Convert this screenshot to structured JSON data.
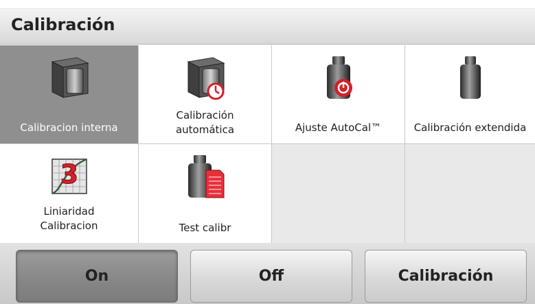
{
  "header": {
    "title": "Calibración"
  },
  "tiles": [
    {
      "label_line1": "Calibracion interna",
      "label_line2": "",
      "icon": "internal-weight-block-icon",
      "selected": true
    },
    {
      "label_line1": "Calibración",
      "label_line2": "automática",
      "icon": "auto-calibration-timer-icon",
      "selected": false
    },
    {
      "label_line1": "Ajuste AutoCal™",
      "label_line2": "",
      "icon": "autocal-weight-icon",
      "selected": false
    },
    {
      "label_line1": "Calibración extendida",
      "label_line2": "",
      "icon": "calibration-weight-icon",
      "selected": false
    },
    {
      "label_line1": "Liniaridad",
      "label_line2": "Calibracion",
      "icon": "linearity-graph-icon",
      "selected": false
    },
    {
      "label_line1": "Test calibr",
      "label_line2": "",
      "icon": "test-calibration-icon",
      "selected": false
    }
  ],
  "footer": {
    "buttons": [
      {
        "label": "On",
        "active": true
      },
      {
        "label": "Off",
        "active": false
      },
      {
        "label": "Calibración",
        "active": false
      }
    ]
  },
  "colors": {
    "selected_tile": "#8f8f8f",
    "accent_red": "#d4202a"
  }
}
